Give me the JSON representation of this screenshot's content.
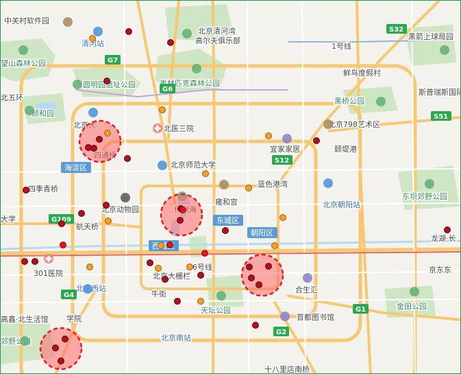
{
  "labels": [
    {
      "text": "中关村软件园",
      "kind": "normal"
    },
    {
      "text": "清河站",
      "kind": "blue"
    },
    {
      "text": "北京清河湾",
      "kind": "normal"
    },
    {
      "text": "高尔夫俱乐部",
      "kind": "normal"
    },
    {
      "text": "黑箭上球局园",
      "kind": "normal"
    },
    {
      "text": "望山森林公园",
      "kind": "park"
    },
    {
      "text": "鲜鸟度假村",
      "kind": "normal"
    },
    {
      "text": "圆明园遗址公园",
      "kind": "park"
    },
    {
      "text": "奥林匹克森林公园",
      "kind": "park"
    },
    {
      "text": "斯普瑞斯国际",
      "kind": "normal"
    },
    {
      "text": "北五环",
      "kind": "normal"
    },
    {
      "text": "颐和园",
      "kind": "park"
    },
    {
      "text": "黑桥公园",
      "kind": "park"
    },
    {
      "text": "北医三院",
      "kind": "normal"
    },
    {
      "text": "北京798艺术区",
      "kind": "normal"
    },
    {
      "text": "宜家家居",
      "kind": "normal"
    },
    {
      "text": "四通桥",
      "kind": "normal"
    },
    {
      "text": "颐堤港",
      "kind": "normal"
    },
    {
      "text": "北京师范大学",
      "kind": "normal"
    },
    {
      "text": "四季青桥",
      "kind": "normal"
    },
    {
      "text": "蓝色港湾",
      "kind": "normal"
    },
    {
      "text": "雍和宫",
      "kind": "normal"
    },
    {
      "text": "北京朝阳站",
      "kind": "blue"
    },
    {
      "text": "东坝郊野公园",
      "kind": "park"
    },
    {
      "text": "北京动物园",
      "kind": "normal"
    },
    {
      "text": "航天桥",
      "kind": "normal"
    },
    {
      "text": "龙湖·长",
      "kind": "normal"
    },
    {
      "text": "301医院",
      "kind": "normal"
    },
    {
      "text": "北京西站",
      "kind": "blue"
    },
    {
      "text": "北京大栅栏",
      "kind": "normal"
    },
    {
      "text": "合生汇",
      "kind": "normal"
    },
    {
      "text": "京东东",
      "kind": "normal"
    },
    {
      "text": "天坛公园",
      "kind": "park"
    },
    {
      "text": "金田公园",
      "kind": "park"
    },
    {
      "text": "首都图书馆",
      "kind": "normal"
    },
    {
      "text": "北京南站",
      "kind": "blue"
    },
    {
      "text": "十八里店南桥",
      "kind": "normal"
    },
    {
      "text": "郊野公园",
      "kind": "park"
    },
    {
      "text": "大学",
      "kind": "normal"
    },
    {
      "text": "北京大",
      "kind": "normal"
    },
    {
      "text": "什刹海",
      "kind": "normal"
    },
    {
      "text": "高鑫·北生活馆",
      "kind": "normal"
    }
  ],
  "districts": [
    {
      "text": "海淀区"
    },
    {
      "text": "东城区"
    },
    {
      "text": "朝阳区"
    },
    {
      "text": "西城区"
    }
  ],
  "road_badges": [
    {
      "text": "G7"
    },
    {
      "text": "G6"
    },
    {
      "text": "S12"
    },
    {
      "text": "S32"
    },
    {
      "text": "S51"
    },
    {
      "text": "G109"
    },
    {
      "text": "G4"
    },
    {
      "text": "G2"
    },
    {
      "text": "G1"
    }
  ],
  "road_texts": [
    {
      "text": "1号线"
    },
    {
      "text": "6号线"
    },
    {
      "text": "牛街"
    },
    {
      "text": "学院"
    }
  ],
  "colors": {
    "background": "#f4f2ec",
    "park": "#cfe6c4",
    "water": "#b8d9f3",
    "major_road": "#f7c873",
    "minor_road": "#ffffff",
    "badge_green": "#2aa84f",
    "district_blue": "#5b9bd5",
    "point_dark_red": "#b01020",
    "point_orange": "#f2a02b",
    "hotspot_fill": "#ff6b6b",
    "hotspot_border": "#e02020",
    "frame": "#1f9a4a"
  },
  "hotspots": [
    {
      "id": "hotspot-haidian",
      "radius_km": 1
    },
    {
      "id": "hotspot-shichahai",
      "radius_km": 1
    },
    {
      "id": "hotspot-guomao",
      "radius_km": 1
    },
    {
      "id": "hotspot-fengtai",
      "radius_km": 1
    }
  ]
}
